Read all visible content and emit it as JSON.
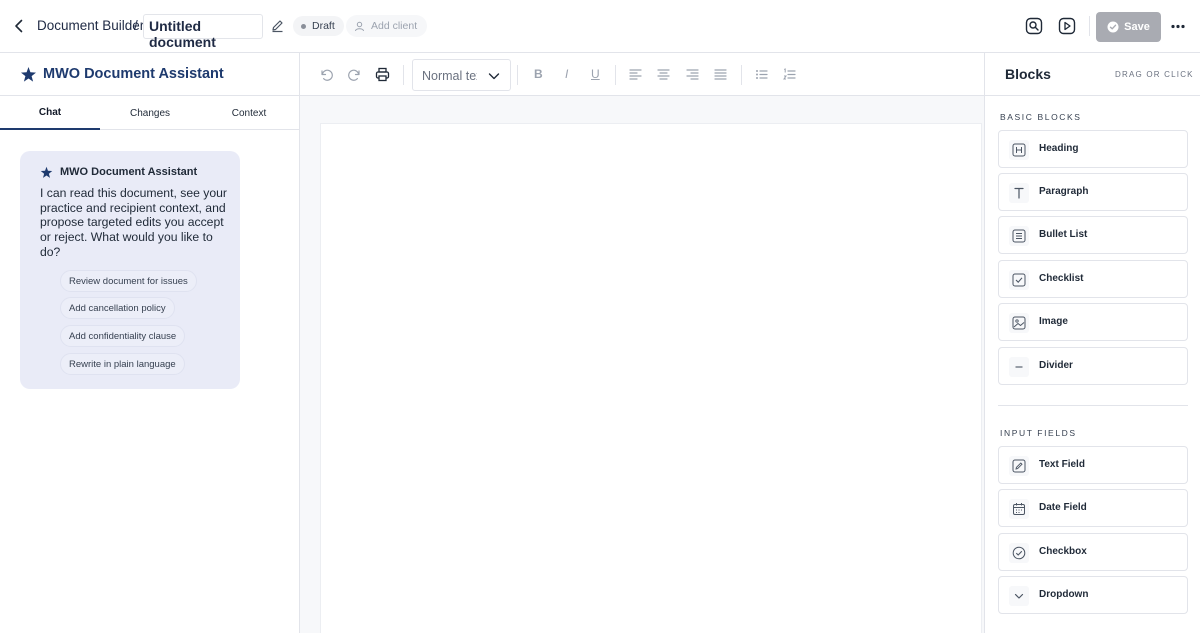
{
  "header": {
    "breadcrumb": "Document Builder",
    "separator": "/",
    "document_title": "Untitled document",
    "status_badge": "Draft",
    "add_client_label": "Add client",
    "save_label": "Save"
  },
  "assistant": {
    "title": "MWO Document Assistant",
    "tabs": [
      {
        "label": "Chat",
        "active": true
      },
      {
        "label": "Changes",
        "active": false
      },
      {
        "label": "Context",
        "active": false
      }
    ],
    "message": {
      "sender": "MWO Document Assistant",
      "text": "I can read this document, see your practice and recipient context, and propose targeted edits you accept or reject. What would you like to do?"
    },
    "suggestions": [
      "Review document for issues",
      "Add cancellation policy",
      "Add confidentiality clause",
      "Rewrite in plain language"
    ]
  },
  "editor": {
    "style_select_value": "Normal text",
    "format_buttons": {
      "bold": "B",
      "italic": "I",
      "underline": "U"
    }
  },
  "blocks_panel": {
    "title": "Blocks",
    "hint": "DRAG OR CLICK",
    "sections": [
      {
        "title": "BASIC BLOCKS",
        "items": [
          {
            "label": "Heading",
            "icon": "heading-icon"
          },
          {
            "label": "Paragraph",
            "icon": "paragraph-icon"
          },
          {
            "label": "Bullet List",
            "icon": "bullet-list-icon"
          },
          {
            "label": "Checklist",
            "icon": "checklist-icon"
          },
          {
            "label": "Image",
            "icon": "image-icon"
          },
          {
            "label": "Divider",
            "icon": "divider-icon"
          }
        ]
      },
      {
        "title": "INPUT FIELDS",
        "items": [
          {
            "label": "Text Field",
            "icon": "text-field-icon"
          },
          {
            "label": "Date Field",
            "icon": "date-field-icon"
          },
          {
            "label": "Checkbox",
            "icon": "checkbox-icon"
          },
          {
            "label": "Dropdown",
            "icon": "dropdown-icon"
          }
        ]
      }
    ]
  },
  "colors": {
    "accent": "#1e3a6e",
    "chat_bubble": "#e9ebf7",
    "save_button": "#a9abb2",
    "border": "#e2e4ea"
  }
}
